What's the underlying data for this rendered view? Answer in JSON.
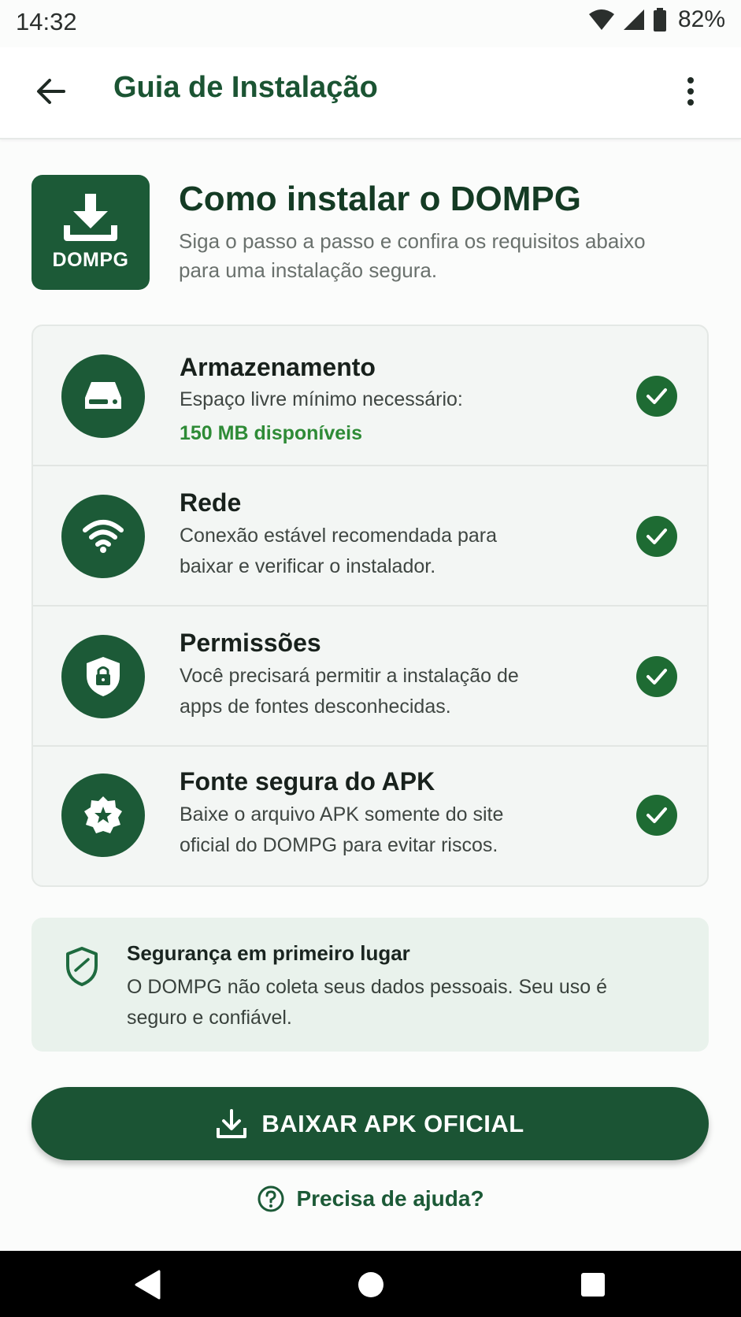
{
  "status_bar": {
    "time": "14:32",
    "battery": "82%"
  },
  "app_bar": {
    "title": "Guia de Instalação"
  },
  "header": {
    "logo_text": "DOMPG",
    "heading": "Como instalar o DOMPG",
    "subtitle": "Siga o passo a passo e confira os requisitos abaixo para uma instalação segura."
  },
  "requirements": [
    {
      "icon": "storage-icon",
      "title": "Armazenamento",
      "description": "Espaço livre mínimo necessário:",
      "highlight": "150 MB disponíveis",
      "status": "check"
    },
    {
      "icon": "wifi-icon",
      "title": "Rede",
      "description": "Conexão estável recomendada para baixar e verificar o instalador.",
      "status": "check"
    },
    {
      "icon": "shield-lock-icon",
      "title": "Permissões",
      "description": "Você precisará permitir a instalação de apps de fontes desconhecidas.",
      "status": "check"
    },
    {
      "icon": "verified-badge-icon",
      "title": "Fonte segura do APK",
      "description": "Baixe o arquivo APK somente do site oficial do DOMPG para evitar riscos.",
      "status": "check"
    }
  ],
  "security_note": {
    "title": "Segurança em primeiro lugar",
    "text": "O DOMPG não coleta seus dados pessoais. Seu uso é seguro e confiável."
  },
  "download_button": {
    "label": "BAIXAR APK OFICIAL"
  },
  "help_link": {
    "label": "Precisa de ajuda?"
  },
  "colors": {
    "primary": "#1c5a37",
    "accent_green": "#2e8b36",
    "card_bg": "#f3f6f4",
    "note_bg": "#e9f2ec"
  }
}
